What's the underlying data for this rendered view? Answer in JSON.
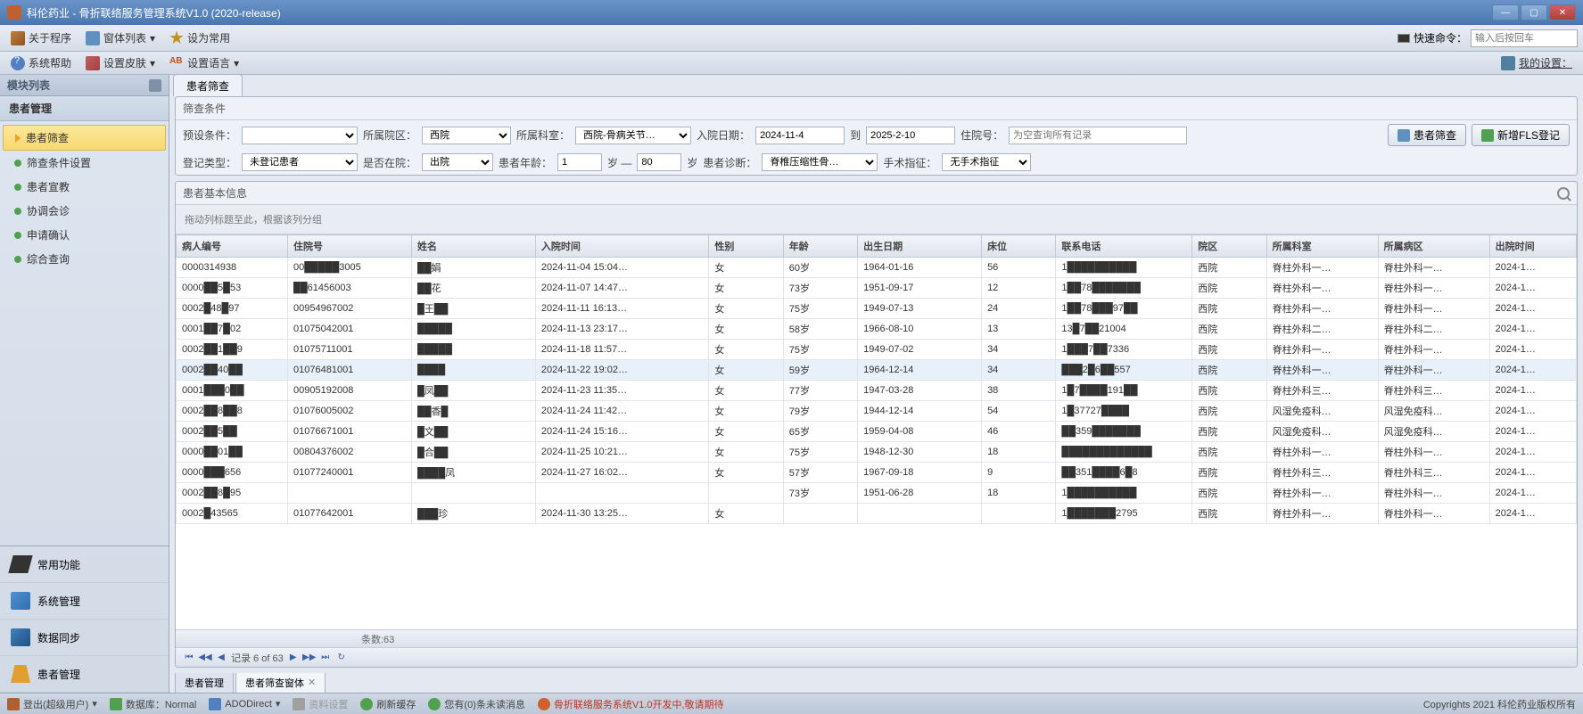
{
  "window": {
    "title": "科伦药业 - 骨折联络服务管理系统V1.0 (2020-release)"
  },
  "menubar1": {
    "about": "关于程序",
    "windows": "窗体列表",
    "setCommon": "设为常用",
    "quickCmdLabel": "快速命令：",
    "quickCmdPlaceholder": "输入后按回车"
  },
  "menubar2": {
    "sysHelp": "系统帮助",
    "setSkin": "设置皮肤",
    "setLang": "设置语言",
    "mySettings": "我的设置："
  },
  "sidebar": {
    "panelTitle": "模块列表",
    "group": "患者管理",
    "items": [
      {
        "label": "患者筛查",
        "active": true
      },
      {
        "label": "筛查条件设置"
      },
      {
        "label": "患者宣教"
      },
      {
        "label": "协调会诊"
      },
      {
        "label": "申请确认"
      },
      {
        "label": "综合查询"
      }
    ],
    "bottom": [
      {
        "label": "常用功能"
      },
      {
        "label": "系统管理"
      },
      {
        "label": "数据同步"
      },
      {
        "label": "患者管理"
      }
    ]
  },
  "tabs": {
    "pageTab": "患者筛查"
  },
  "filter": {
    "panelTitle": "筛查条件",
    "preset": "预设条件：",
    "hospital": "所属院区：",
    "hospitalVal": "西院",
    "dept": "所属科室：",
    "deptVal": "西院-骨病关节…",
    "admDate": "入院日期：",
    "admFrom": "2024-11-4",
    "to": "到",
    "admTo": "2025-2-10",
    "inpNo": "住院号：",
    "inpNoPh": "为空查询所有记录",
    "regType": "登记类型：",
    "regTypeVal": "未登记患者",
    "inHosp": "是否在院：",
    "inHospVal": "出院",
    "age": "患者年龄：",
    "ageFrom": "1",
    "ageSep": "岁 —",
    "ageTo": "80",
    "ageUnit": "岁",
    "diag": "患者诊断：",
    "diagVal": "脊椎压缩性骨…",
    "surg": "手术指征：",
    "surgVal": "无手术指征",
    "btnFilter": "患者筛查",
    "btnAdd": "新增FLS登记"
  },
  "grid": {
    "panelTitle": "患者基本信息",
    "groupHint": "拖动列标题至此，根据该列分组",
    "columns": [
      "病人编号",
      "住院号",
      "姓名",
      "入院时间",
      "性别",
      "年龄",
      "出生日期",
      "床位",
      "联系电话",
      "院区",
      "所属科室",
      "所属病区",
      "出院时间"
    ],
    "rows": [
      {
        "pid": "0000314938",
        "inp": "00█████3005",
        "name": "██娟",
        "adm": "2024-11-04 15:04…",
        "sex": "女",
        "age": "60岁",
        "dob": "1964-01-16",
        "bed": "56",
        "tel": "1██████████",
        "loc": "西院",
        "dept": "脊柱外科一…",
        "ward": "脊柱外科一…",
        "dis": "2024-1…"
      },
      {
        "pid": "0000██5█53",
        "inp": "██61456003",
        "name": "██花",
        "adm": "2024-11-07 14:47…",
        "sex": "女",
        "age": "73岁",
        "dob": "1951-09-17",
        "bed": "12",
        "tel": "1██78███████",
        "loc": "西院",
        "dept": "脊柱外科一…",
        "ward": "脊柱外科一…",
        "dis": "2024-1…"
      },
      {
        "pid": "0002█48█97",
        "inp": "00954967002",
        "name": "█王██",
        "adm": "2024-11-11 16:13…",
        "sex": "女",
        "age": "75岁",
        "dob": "1949-07-13",
        "bed": "24",
        "tel": "1██78███97██",
        "loc": "西院",
        "dept": "脊柱外科一…",
        "ward": "脊柱外科一…",
        "dis": "2024-1…"
      },
      {
        "pid": "0001██7█02",
        "inp": "01075042001",
        "name": "█████",
        "adm": "2024-11-13 23:17…",
        "sex": "女",
        "age": "58岁",
        "dob": "1966-08-10",
        "bed": "13",
        "tel": "13█7██21004",
        "loc": "西院",
        "dept": "脊柱外科二…",
        "ward": "脊柱外科二…",
        "dis": "2024-1…"
      },
      {
        "pid": "0002██1██9",
        "inp": "01075711001",
        "name": "█████",
        "adm": "2024-11-18 11:57…",
        "sex": "女",
        "age": "75岁",
        "dob": "1949-07-02",
        "bed": "34",
        "tel": "1███7██7336",
        "loc": "西院",
        "dept": "脊柱外科一…",
        "ward": "脊柱外科一…",
        "dis": "2024-1…"
      },
      {
        "pid": "0002██40██",
        "inp": "01076481001",
        "name": "████",
        "adm": "2024-11-22 19:02…",
        "sex": "女",
        "age": "59岁",
        "dob": "1964-12-14",
        "bed": "34",
        "tel": "███2█6██557",
        "loc": "西院",
        "dept": "脊柱外科一…",
        "ward": "脊柱外科一…",
        "dis": "2024-1…",
        "sel": true
      },
      {
        "pid": "0001███0██",
        "inp": "00905192008",
        "name": "█凤██",
        "adm": "2024-11-23 11:35…",
        "sex": "女",
        "age": "77岁",
        "dob": "1947-03-28",
        "bed": "38",
        "tel": "1█7████191██",
        "loc": "西院",
        "dept": "脊柱外科三…",
        "ward": "脊柱外科三…",
        "dis": "2024-1…"
      },
      {
        "pid": "0002██8██8",
        "inp": "01076005002",
        "name": "██香█",
        "adm": "2024-11-24 11:42…",
        "sex": "女",
        "age": "79岁",
        "dob": "1944-12-14",
        "bed": "54",
        "tel": "1█37727████",
        "loc": "西院",
        "dept": "风湿免疫科…",
        "ward": "风湿免疫科…",
        "dis": "2024-1…"
      },
      {
        "pid": "0002██5██",
        "inp": "01076671001",
        "name": "█文██",
        "adm": "2024-11-24 15:16…",
        "sex": "女",
        "age": "65岁",
        "dob": "1959-04-08",
        "bed": "46",
        "tel": "██359███████",
        "loc": "西院",
        "dept": "风湿免疫科…",
        "ward": "风湿免疫科…",
        "dis": "2024-1…"
      },
      {
        "pid": "0000██01██",
        "inp": "00804376002",
        "name": "█合██",
        "adm": "2024-11-25 10:21…",
        "sex": "女",
        "age": "75岁",
        "dob": "1948-12-30",
        "bed": "18",
        "tel": "█████████████",
        "loc": "西院",
        "dept": "脊柱外科一…",
        "ward": "脊柱外科一…",
        "dis": "2024-1…"
      },
      {
        "pid": "0000███656",
        "inp": "01077240001",
        "name": "████凤",
        "adm": "2024-11-27 16:02…",
        "sex": "女",
        "age": "57岁",
        "dob": "1967-09-18",
        "bed": "9",
        "tel": "██351████6█8",
        "loc": "西院",
        "dept": "脊柱外科三…",
        "ward": "脊柱外科三…",
        "dis": "2024-1…"
      },
      {
        "pid": "0002██8█95",
        "inp": "",
        "name": "",
        "adm": "",
        "sex": "",
        "age": "73岁",
        "dob": "1951-06-28",
        "bed": "18",
        "tel": "1██████████",
        "loc": "西院",
        "dept": "脊柱外科一…",
        "ward": "脊柱外科一…",
        "dis": "2024-1…"
      },
      {
        "pid": "0002█43565",
        "inp": "01077642001",
        "name": "███珍",
        "adm": "2024-11-30 13:25…",
        "sex": "女",
        "age": "",
        "dob": "",
        "bed": "",
        "tel": "1███████2795",
        "loc": "西院",
        "dept": "脊柱外科一…",
        "ward": "脊柱外科一…",
        "dis": "2024-1…"
      }
    ],
    "footer": "条数:63",
    "navRecord": "记录 6 of 63"
  },
  "bottomTabs": {
    "t1": "患者管理",
    "t2": "患者筛查窗体"
  },
  "status": {
    "logout": "登出(超级用户)",
    "db": "数据库：Normal",
    "ado": "ADODirect",
    "ds": "资料设置",
    "refresh": "刷新缓存",
    "msg": "您有(0)条未读消息",
    "dev": "骨折联络服务系统V1.0开发中,敬请期待",
    "copyright": "Copyrights 2021 科伦药业版权所有"
  }
}
